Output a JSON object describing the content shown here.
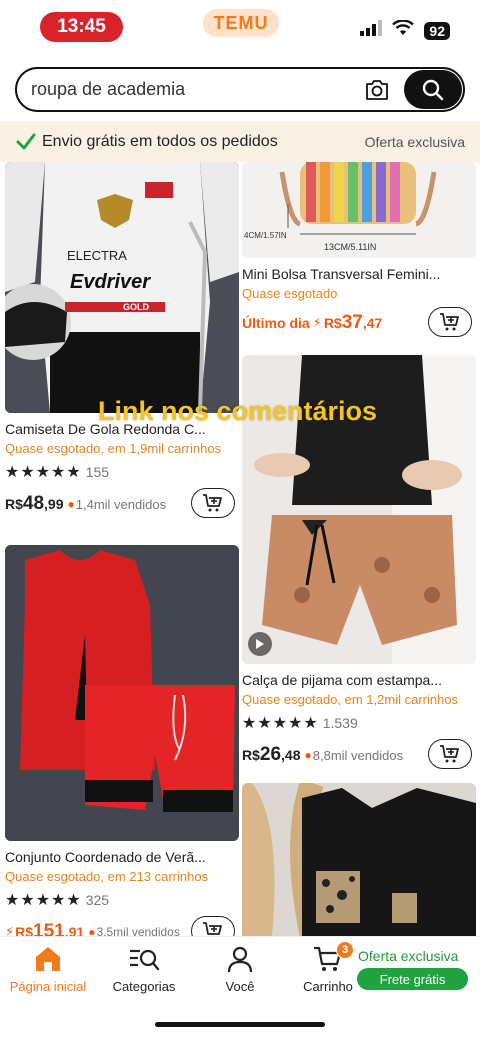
{
  "status_bar": {
    "time": "13:45",
    "app": "TEMU",
    "battery": "92"
  },
  "search": {
    "value": "roupa de academia"
  },
  "banner": {
    "text": "Envio grátis em todos os pedidos",
    "offer": "Oferta exclusiva"
  },
  "overlay": {
    "text": "Link nos comentários"
  },
  "products": [
    {
      "title": "Camiseta De Gola Redonda C...",
      "status": "Quase esgotado, em 1,9mil carrinhos",
      "rating_count": "155",
      "stars": 4.5,
      "currency": "R$",
      "price_main": "48",
      "price_dec": ",99",
      "sold": "1,4mil vendidos"
    },
    {
      "title": "Mini Bolsa Transversal Femini...",
      "status": "Quase esgotado",
      "price_prefix": "Último dia",
      "currency": "R$",
      "price_main": "37",
      "price_dec": ",47"
    },
    {
      "title": "Calça de pijama com estampa...",
      "status": "Quase esgotado, em 1,2mil carrinhos",
      "rating_count": "1.539",
      "stars": 4.5,
      "currency": "R$",
      "price_main": "26",
      "price_dec": ",48",
      "sold": "8,8mil vendidos"
    },
    {
      "title": "Conjunto Coordenado de Verã...",
      "status": "Quase esgotado, em 213 carrinhos",
      "rating_count": "325",
      "stars": 5,
      "currency": "R$",
      "price_main": "151",
      "price_dec": ",91",
      "sold": "3,5mil vendidos"
    }
  ],
  "image_labels": {
    "bag_dim_a": "4CM/1.57IN",
    "bag_dim_b": "13CM/5.11IN",
    "shirt_brand": "Evdriver",
    "shirt_text": "ELECTRA",
    "shirt_badge": "GOLD"
  },
  "bottom_nav": {
    "items": [
      {
        "label": "Página inicial",
        "icon": "home-icon"
      },
      {
        "label": "Categorias",
        "icon": "categories-icon"
      },
      {
        "label": "Você",
        "icon": "user-icon"
      },
      {
        "label": "Carrinho",
        "icon": "cart-icon"
      }
    ],
    "cart_count": "3",
    "offer_label": "Oferta exclusiva",
    "free_label": "Frete grátis"
  },
  "colors": {
    "accent": "#f27a1a",
    "green": "#1fa23f",
    "alert": "#d8232a"
  }
}
